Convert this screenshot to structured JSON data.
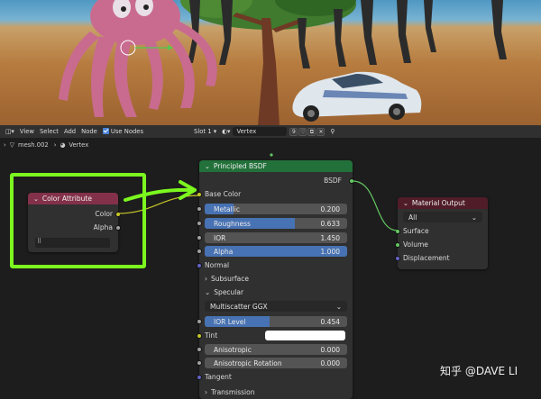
{
  "header": {
    "menus": [
      "View",
      "Select",
      "Add",
      "Node"
    ],
    "use_nodes_label": "Use Nodes",
    "slot_label": "Slot 1",
    "uv_label": "Vertex",
    "users_count": "9"
  },
  "breadcrumb": {
    "mesh": "mesh.002",
    "attribute": "Vertex"
  },
  "color_attr_node": {
    "title": "Color Attribute",
    "out_color": "Color",
    "out_alpha": "Alpha"
  },
  "bsdf_node": {
    "title": "Principled BSDF",
    "output": "BSDF",
    "base_color": "Base Color",
    "metallic": {
      "label": "Metallic",
      "value": "0.200",
      "fill": 0.2
    },
    "roughness": {
      "label": "Roughness",
      "value": "0.633",
      "fill": 0.633
    },
    "ior": {
      "label": "IOR",
      "value": "1.450"
    },
    "alpha": {
      "label": "Alpha",
      "value": "1.000",
      "fill": 1.0
    },
    "normal": "Normal",
    "subsurface": "Subsurface",
    "specular": "Specular",
    "distribution": "Multiscatter GGX",
    "ior_level": {
      "label": "IOR Level",
      "value": "0.454",
      "fill": 0.454
    },
    "tint": "Tint",
    "anisotropic": {
      "label": "Anisotropic",
      "value": "0.000"
    },
    "anisotropic_rotation": {
      "label": "Anisotropic Rotation",
      "value": "0.000"
    },
    "tangent": "Tangent",
    "transmission": "Transmission"
  },
  "output_node": {
    "title": "Material Output",
    "target": "All",
    "surface": "Surface",
    "volume": "Volume",
    "displacement": "Displacement"
  },
  "watermark": "知乎 @DAVE LI",
  "colors": {
    "color_attr_header": "#83314a",
    "bsdf_header": "#23713a",
    "output_header": "#501c28",
    "highlight": "#7cf71f",
    "slider_fill": "#4772b3"
  }
}
